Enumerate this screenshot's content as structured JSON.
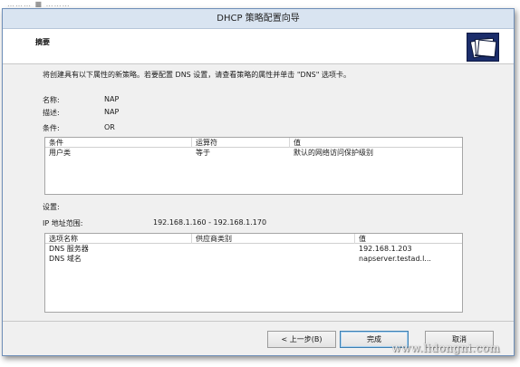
{
  "window": {
    "title": "DHCP 策略配置向导",
    "header_title": "摘要",
    "header_icon": "folder-files-icon"
  },
  "top_strip_text": "……… ■ ………",
  "intro_text": "将创建具有以下属性的新策略。若要配置 DNS 设置，请查看策略的属性并单击 \"DNS\" 选项卡。",
  "properties": [
    {
      "label": "名称:",
      "value": "NAP"
    },
    {
      "label": "描述:",
      "value": "NAP"
    },
    {
      "label": "条件:",
      "value": "OR"
    }
  ],
  "conditions_table": {
    "columns": [
      "条件",
      "运算符",
      "值"
    ],
    "rows": [
      [
        "用户类",
        "等于",
        "默认的网络访问保护级别"
      ]
    ]
  },
  "settings_label": "设置:",
  "ip_range": {
    "label": "IP 地址范围:",
    "value": "192.168.1.160 - 192.168.1.170"
  },
  "options_table": {
    "columns": [
      "选项名称",
      "供应商类别",
      "值"
    ],
    "rows": [
      [
        "DNS 服务器",
        "",
        "192.168.1.203"
      ],
      [
        "DNS 域名",
        "",
        "napserver.testad.l..."
      ]
    ]
  },
  "buttons": {
    "back": "< 上一步(B)",
    "finish": "完成",
    "cancel": "取消"
  },
  "watermark": "www.lidongni.com"
}
